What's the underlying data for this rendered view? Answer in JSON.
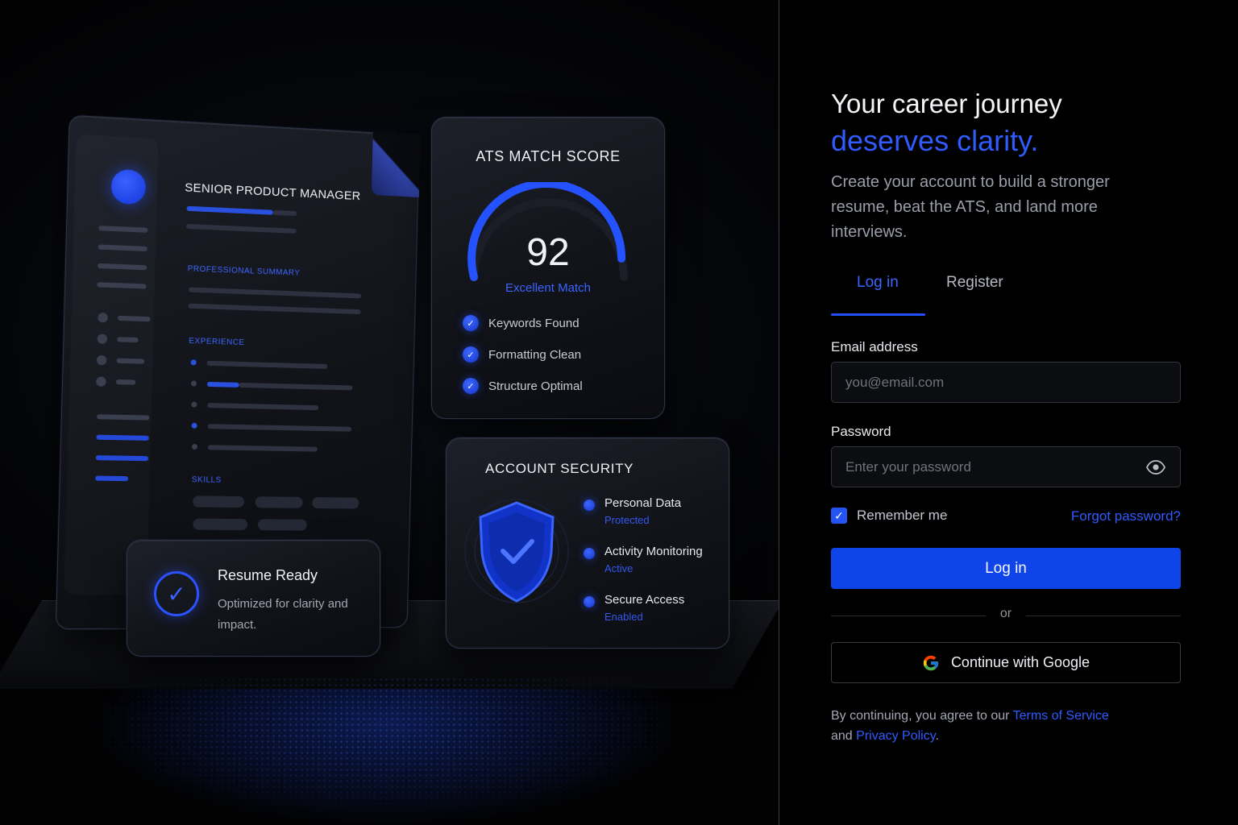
{
  "hero": {
    "resume": {
      "title": "Senior Product Manager",
      "sections": [
        "Professional Summary",
        "Experience",
        "Skills"
      ]
    },
    "ats_card": {
      "title": "ATS MATCH SCORE",
      "score": "92",
      "score_value": 92,
      "match_label": "Excellent Match",
      "checks": [
        "Keywords Found",
        "Formatting Clean",
        "Structure Optimal"
      ]
    },
    "security_card": {
      "title": "ACCOUNT SECURITY",
      "items": [
        {
          "name": "Personal Data",
          "state": "Protected"
        },
        {
          "name": "Activity Monitoring",
          "state": "Active"
        },
        {
          "name": "Secure Access",
          "state": "Enabled"
        }
      ]
    },
    "ready_card": {
      "title": "Resume Ready",
      "subtitle": "Optimized for clarity and impact."
    }
  },
  "auth": {
    "headline_line1": "Your career journey",
    "headline_line2": "deserves clarity.",
    "lead": "Create your account to build a stronger resume, beat the ATS, and land more interviews.",
    "tabs": [
      {
        "label": "Log in",
        "active": true
      },
      {
        "label": "Register",
        "active": false
      }
    ],
    "email": {
      "label": "Email address",
      "placeholder": "you@email.com",
      "value": ""
    },
    "password": {
      "label": "Password",
      "placeholder": "Enter your password",
      "value": ""
    },
    "remember": {
      "label": "Remember me",
      "checked": true
    },
    "forgot_label": "Forgot password?",
    "submit_label": "Log in",
    "or_label": "or",
    "google_label": "Continue with Google",
    "legal": {
      "prefix": "By continuing, you agree to our",
      "terms": "Terms of Service",
      "middle": "and",
      "privacy": "Privacy Policy",
      "suffix": "."
    }
  },
  "colors": {
    "accent": "#2f5bff",
    "button": "#0f45e8",
    "background": "#000000"
  },
  "icons": [
    "eye-icon",
    "google-icon",
    "check-icon",
    "shield-icon"
  ]
}
